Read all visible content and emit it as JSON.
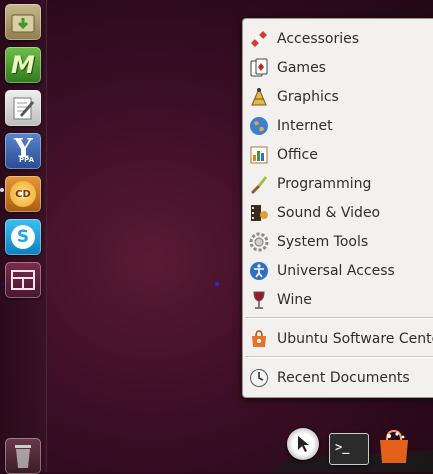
{
  "menu": {
    "items": [
      {
        "label": "Accessories",
        "icon": "accessories-icon"
      },
      {
        "label": "Games",
        "icon": "games-icon"
      },
      {
        "label": "Graphics",
        "icon": "graphics-icon"
      },
      {
        "label": "Internet",
        "icon": "internet-icon"
      },
      {
        "label": "Office",
        "icon": "office-icon"
      },
      {
        "label": "Programming",
        "icon": "programming-icon"
      },
      {
        "label": "Sound & Video",
        "icon": "sound-video-icon"
      },
      {
        "label": "System Tools",
        "icon": "system-tools-icon"
      },
      {
        "label": "Universal Access",
        "icon": "universal-access-icon"
      },
      {
        "label": "Wine",
        "icon": "wine-icon"
      }
    ],
    "software_center": {
      "label": "Ubuntu Software Cente",
      "icon": "software-center-icon"
    },
    "recent": {
      "label": "Recent Documents",
      "icon": "recent-documents-icon"
    }
  },
  "launcher": {
    "icons": [
      "home-folder-icon",
      "mint-m-icon",
      "text-editor-icon",
      "ppa-manager-icon",
      "cd-burner-icon",
      "skype-icon",
      "workspace-switcher-icon",
      "trash-icon"
    ],
    "ppa_text": "PPA",
    "mint_text": "M",
    "cd_text": "CD"
  },
  "tray": {
    "terminal_prompt": ">_",
    "icons": [
      "cursor-icon",
      "terminal-icon",
      "shopping-bag-icon"
    ]
  },
  "colors": {
    "wallpaper": "#3e0f26",
    "menu_bg": "#f2f1f0",
    "text": "#2e2e2e",
    "skype": "#1ca8e8",
    "ppa": "#3860a8"
  }
}
